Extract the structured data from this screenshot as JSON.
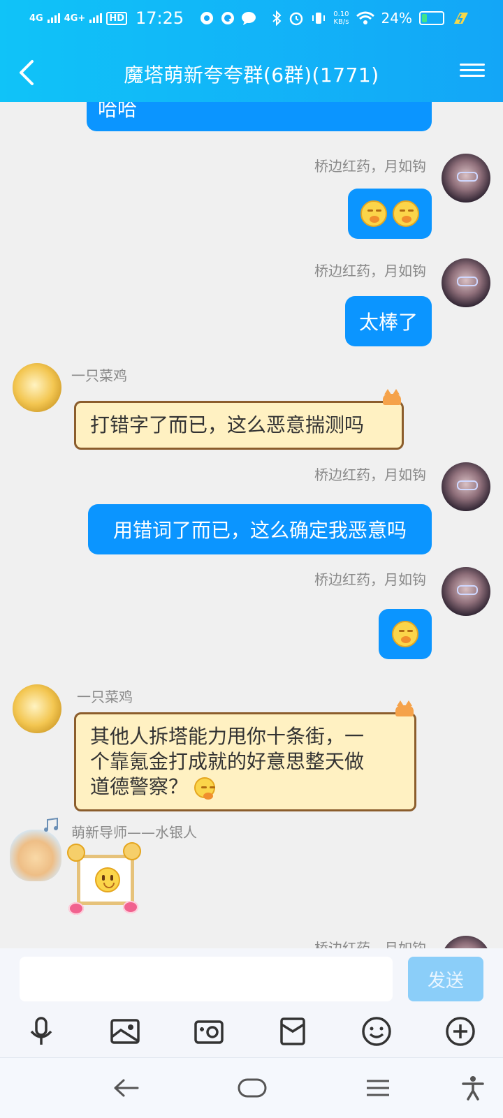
{
  "status_bar": {
    "signal1": "4G",
    "signal2": "4G+",
    "hd": "HD",
    "time": "17:25",
    "net_speed": "0.10",
    "net_unit": "KB/s",
    "battery": "24%",
    "battery_level": 0.24
  },
  "header": {
    "title": "魔塔萌新夸夸群(6群)(1771)"
  },
  "messages": [
    {
      "text": "哈哈"
    },
    {
      "sender": "桥边红药，月如钩"
    },
    {
      "sender": "桥边红药，月如钩",
      "text": "太棒了"
    },
    {
      "sender": "一只菜鸡",
      "text": "打错字了而已，这么恶意揣测吗"
    },
    {
      "sender": "桥边红药，月如钩",
      "text": "用错词了而已，这么确定我恶意吗"
    },
    {
      "sender": "桥边红药，月如钩"
    },
    {
      "sender": "一只菜鸡",
      "line1": "其他人拆塔能力甩你十条街，一",
      "line2": "个靠氪金打成就的好意思整天做",
      "line3": "道德警察？"
    },
    {
      "sender": "萌新导师——水银人"
    },
    {
      "sender": "桥边红药，月如钩"
    }
  ],
  "input": {
    "placeholder": "",
    "send_label": "发送"
  },
  "icons": {
    "toolbar": [
      "microphone-icon",
      "image-icon",
      "camera-icon",
      "red-packet-icon",
      "emoji-icon",
      "plus-icon"
    ],
    "nav": [
      "nav-back-icon",
      "nav-home-icon",
      "nav-menu-icon",
      "accessibility-icon"
    ]
  },
  "colors": {
    "header_start": "#10c3f8",
    "header_end": "#13a6f7",
    "my_bubble": "#0b95ff",
    "paper_bubble": "#fff1c2",
    "send_button": "#8bcef9"
  }
}
